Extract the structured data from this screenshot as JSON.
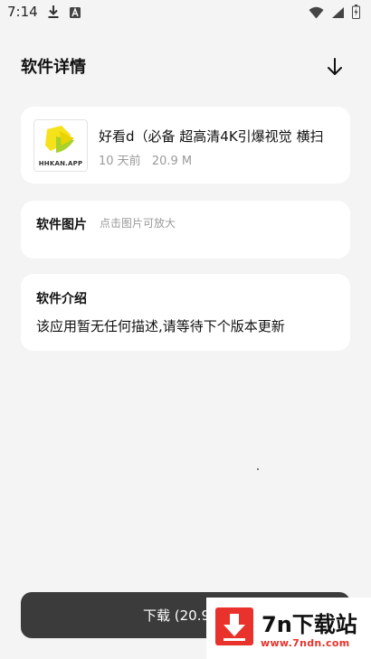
{
  "status_bar": {
    "time": "7:14",
    "left_icons": [
      "download-icon",
      "notification-a-icon"
    ],
    "right_icons": [
      "wifi-icon",
      "signal-icon",
      "battery-icon"
    ]
  },
  "header": {
    "title": "软件详情",
    "action_icon": "arrow-down-icon"
  },
  "app_card": {
    "icon_text": "HHKAN.APP",
    "name": "好看d（必备 超高清4K引爆视觉 横扫",
    "time_ago": "10 天前",
    "size": "20.9 M"
  },
  "images_section": {
    "label": "软件图片",
    "hint": "点击图片可放大"
  },
  "intro_section": {
    "label": "软件介绍",
    "text": "该应用暂无任何描述,请等待下个版本更新"
  },
  "bottom_button": {
    "label": "下载 (20.9"
  },
  "watermark": {
    "title": "7n下载站",
    "url": "www.7ndn.com"
  },
  "colors": {
    "background": "#f4f4f4",
    "card": "#ffffff",
    "button": "#3b3b3b",
    "watermark_red": "#e8322b",
    "muted_text": "#9a9a9a"
  }
}
